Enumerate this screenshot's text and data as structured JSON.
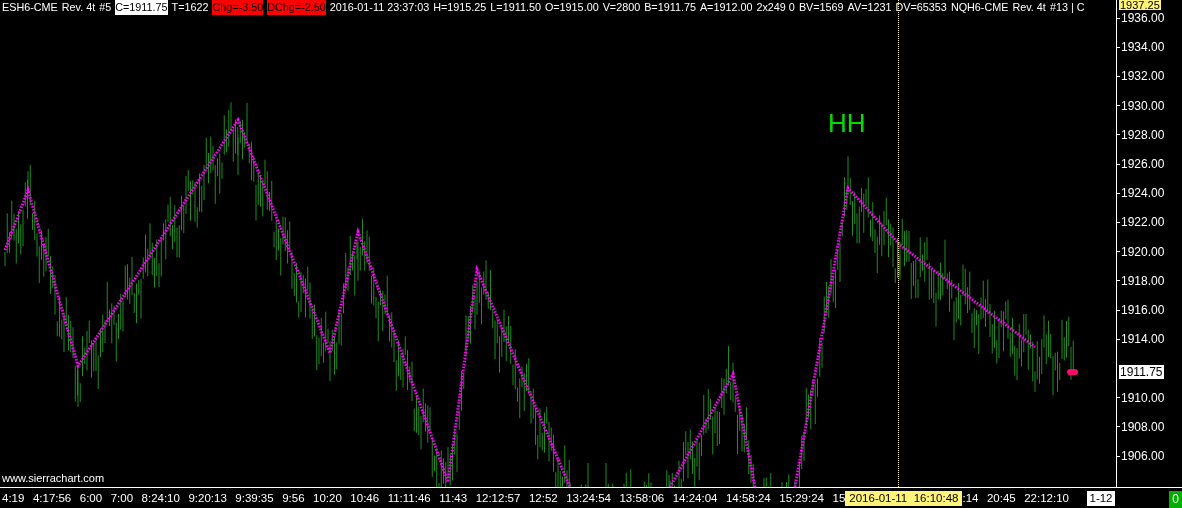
{
  "quote_bar": [
    {
      "text": "ESH6-CME",
      "kind": "plain"
    },
    {
      "text": "Rev. 4t",
      "kind": "plain"
    },
    {
      "text": "#5",
      "kind": "plain"
    },
    {
      "text": "C=1911.75",
      "kind": "highlight"
    },
    {
      "text": "T=1622",
      "kind": "plain"
    },
    {
      "text": "Chg=-3.50",
      "kind": "alert"
    },
    {
      "text": "DChg=-2.50",
      "kind": "alert"
    },
    {
      "text": "2016-01-11 23:37:03",
      "kind": "plain"
    },
    {
      "text": "H=1915.25",
      "kind": "plain"
    },
    {
      "text": "L=1911.50",
      "kind": "plain"
    },
    {
      "text": "O=1915.00",
      "kind": "plain"
    },
    {
      "text": "V=2800",
      "kind": "plain"
    },
    {
      "text": "B=1911.75",
      "kind": "plain"
    },
    {
      "text": "A=1912.00",
      "kind": "plain"
    },
    {
      "text": "2x249 0",
      "kind": "plain"
    },
    {
      "text": "BV=1569",
      "kind": "plain"
    },
    {
      "text": "AV=1231",
      "kind": "plain"
    },
    {
      "text": "DV=65353",
      "kind": "plain"
    },
    {
      "text": "NQH6-CME",
      "kind": "plain"
    },
    {
      "text": "Rev. 4t",
      "kind": "plain"
    },
    {
      "text": "#13 | C",
      "kind": "plain"
    }
  ],
  "chart": {
    "annotation": "HH",
    "site_label": "www.sierrachart.com"
  },
  "price_axis": {
    "cursor_price": "1937.25",
    "labels_above_last": [
      "1936.00",
      "1934.00",
      "1932.00",
      "1930.00",
      "1928.00",
      "1926.00",
      "1924.00",
      "1922.00",
      "1920.00",
      "1918.00",
      "1916.00",
      "1914.00"
    ],
    "labels_below_last": [
      "1910.00",
      "1908.00",
      "1906.00"
    ],
    "last_price": "1911.75"
  },
  "time_axis": {
    "labels": [
      {
        "text": "4:19",
        "kind": "time"
      },
      {
        "text": "4:17:56",
        "kind": "time"
      },
      {
        "text": "6:00",
        "kind": "time"
      },
      {
        "text": "7:00",
        "kind": "time"
      },
      {
        "text": "8:24:10",
        "kind": "time"
      },
      {
        "text": "9:20:13",
        "kind": "time"
      },
      {
        "text": "9:39:35",
        "kind": "time"
      },
      {
        "text": "9:56",
        "kind": "time"
      },
      {
        "text": "10:20",
        "kind": "time"
      },
      {
        "text": "10:46",
        "kind": "time"
      },
      {
        "text": "11:11:46",
        "kind": "time"
      },
      {
        "text": "11:43",
        "kind": "time"
      },
      {
        "text": "12:12:57",
        "kind": "time"
      },
      {
        "text": "12:52",
        "kind": "time"
      },
      {
        "text": "13:24:54",
        "kind": "time"
      },
      {
        "text": "13:58:06",
        "kind": "time"
      },
      {
        "text": "14:24:04",
        "kind": "time"
      },
      {
        "text": "14:58:24",
        "kind": "time"
      },
      {
        "text": "15:29:24",
        "kind": "time"
      },
      {
        "text": "15",
        "kind": "time"
      },
      {
        "text": "2016-01-11  16:10:48",
        "kind": "cursor"
      },
      {
        "text": ":14",
        "kind": "time"
      },
      {
        "text": "20:45",
        "kind": "time"
      },
      {
        "text": "22:12:10",
        "kind": "time"
      },
      {
        "text": "1-12",
        "kind": "date"
      }
    ],
    "counter": "0"
  }
}
